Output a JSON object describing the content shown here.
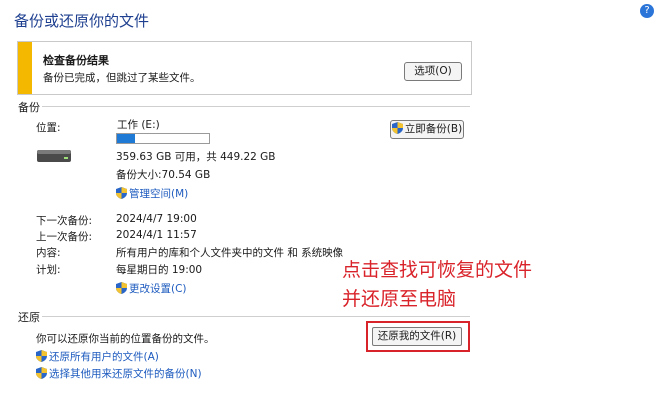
{
  "window": {
    "title": "备份或还原你的文件"
  },
  "alert": {
    "title": "检查备份结果",
    "message": "备份已完成，但跳过了某些文件。",
    "options_button": "选项(O)"
  },
  "backup_section": {
    "heading": "备份",
    "location_label": "位置:",
    "drive_name": "工作 (E:)",
    "drive_usage_fraction": 0.2,
    "space_info": "359.63 GB 可用，共 449.22 GB",
    "backup_size": "备份大小:70.54 GB",
    "manage_space_link": "管理空间(M)",
    "backup_now_button": "立即备份(B)",
    "next_backup_label": "下一次备份:",
    "next_backup_value": "2024/4/7 19:00",
    "last_backup_label": "上一次备份:",
    "last_backup_value": "2024/4/1 11:57",
    "contents_label": "内容:",
    "contents_value": "所有用户的库和个人文件夹中的文件 和 系统映像",
    "schedule_label": "计划:",
    "schedule_value": "每星期日的 19:00",
    "change_settings_link": "更改设置(C)"
  },
  "restore_section": {
    "heading": "还原",
    "description": "你可以还原你当前的位置备份的文件。",
    "restore_my_files_button": "还原我的文件(R)",
    "restore_all_users_link": "还原所有用户的文件(A)",
    "select_other_backup_link": "选择其他用来还原文件的备份(N)"
  },
  "annotation": {
    "line1": "点击查找可恢复的文件",
    "line2": "并还原至电脑",
    "color": "#d9232a"
  },
  "colors": {
    "accent": "#1e5bbf",
    "warning": "#f5b800",
    "progress": "#1f7ad6"
  },
  "icons": {
    "help": "help-icon",
    "shield": "uac-shield-icon",
    "drive": "hard-drive-icon"
  }
}
